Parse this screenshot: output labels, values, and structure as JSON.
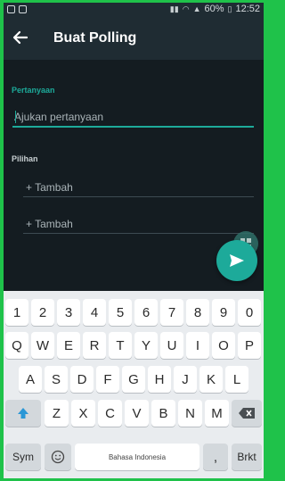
{
  "status_bar": {
    "battery": "60%",
    "time": "12:52"
  },
  "app_bar": {
    "title": "Buat Polling"
  },
  "form": {
    "question_label": "Pertanyaan",
    "question_placeholder": "Ajukan pertanyaan",
    "choices_label": "Pilihan",
    "option_placeholders": [
      "+ Tambah",
      "+ Tambah"
    ]
  },
  "keyboard": {
    "number_row": [
      "1",
      "2",
      "3",
      "4",
      "5",
      "6",
      "7",
      "8",
      "9",
      "0"
    ],
    "row1": [
      "Q",
      "W",
      "E",
      "R",
      "T",
      "Y",
      "U",
      "I",
      "O",
      "P"
    ],
    "row2": [
      "A",
      "S",
      "D",
      "F",
      "G",
      "H",
      "J",
      "K",
      "L"
    ],
    "row3": [
      "Z",
      "X",
      "C",
      "V",
      "B",
      "N",
      "M"
    ],
    "sym_label": "Sym",
    "space_label": "Bahasa Indonesia",
    "enter_label": "Brkt",
    "comma_label": ","
  },
  "colors": {
    "accent": "#1daa9a",
    "background": "#141c21",
    "app_bar": "#1f2c33",
    "frame": "#1fc24a"
  },
  "icons": [
    "back-arrow-icon",
    "send-icon",
    "grid-icon",
    "shift-icon",
    "backspace-icon",
    "emoji-icon"
  ]
}
